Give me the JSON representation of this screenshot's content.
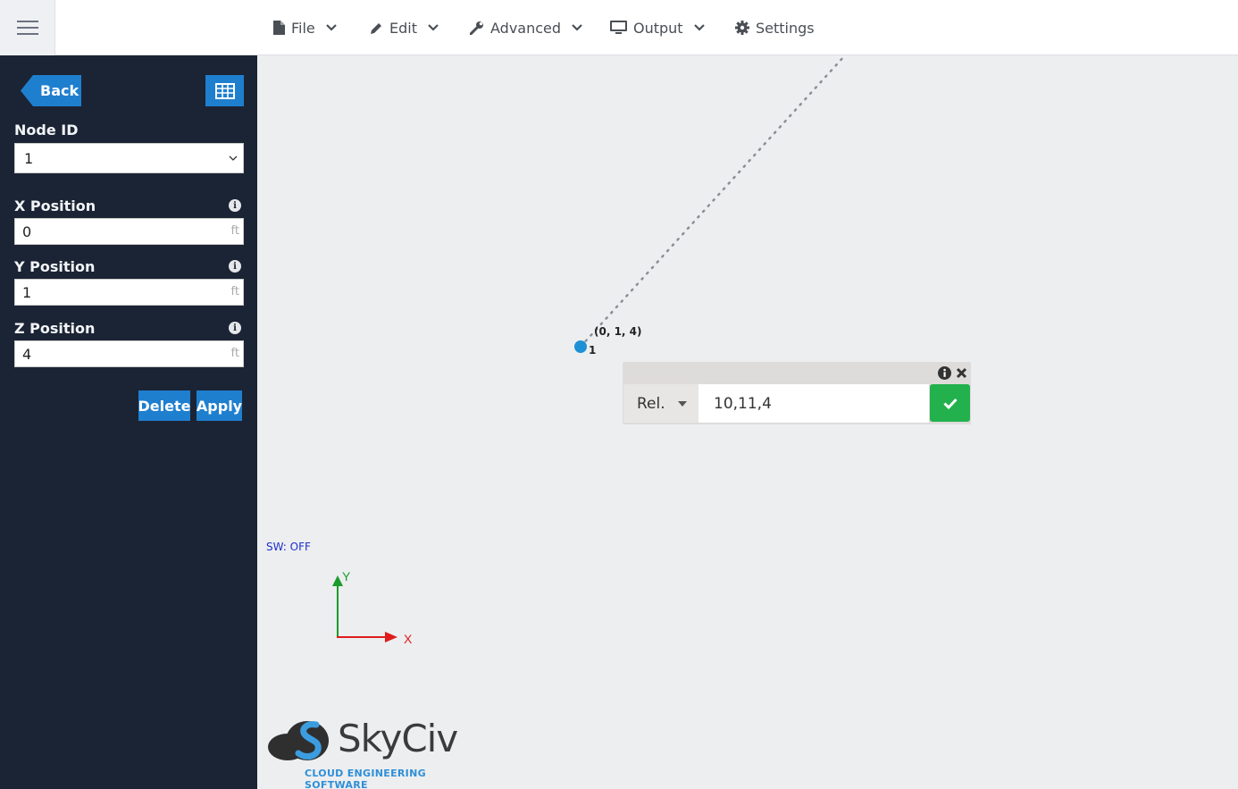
{
  "menu": {
    "file": "File",
    "edit": "Edit",
    "advanced": "Advanced",
    "output": "Output",
    "settings": "Settings"
  },
  "sidebar": {
    "back_label": "Back",
    "node_id_label": "Node ID",
    "node_id_value": "1",
    "x_label": "X Position",
    "x_value": "0",
    "y_label": "Y Position",
    "y_value": "1",
    "z_label": "Z Position",
    "z_value": "4",
    "unit": "ft",
    "delete_label": "Delete",
    "apply_label": "Apply"
  },
  "canvas": {
    "node_coords": "(0, 1, 4)",
    "node_id": "1",
    "sw_status": "SW: OFF",
    "axis_x": "X",
    "axis_y": "Y"
  },
  "popup": {
    "mode": "Rel.",
    "input_value": "10,11,4"
  },
  "logo": {
    "name": "SkyCiv",
    "tagline": "CLOUD ENGINEERING SOFTWARE"
  },
  "colors": {
    "sidebar_bg": "#1b2434",
    "accent_blue": "#1f7fcf",
    "confirm_green": "#22b14c",
    "node_blue": "#1e90d6"
  }
}
